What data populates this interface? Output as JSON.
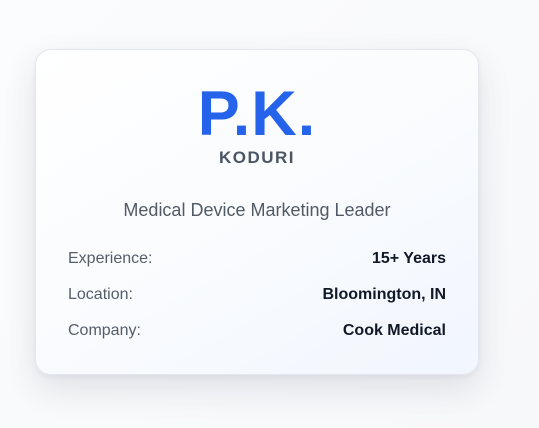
{
  "profile": {
    "initials": "P.K.",
    "surname": "KODURI",
    "role": "Medical Device Marketing Leader"
  },
  "details": [
    {
      "label": "Experience:",
      "value": "15+ Years"
    },
    {
      "label": "Location:",
      "value": "Bloomington, IN"
    },
    {
      "label": "Company:",
      "value": "Cook Medical"
    }
  ],
  "colors": {
    "accent": "#2563eb",
    "surname": "#4b5563",
    "label": "#555d69",
    "value": "#111827"
  }
}
